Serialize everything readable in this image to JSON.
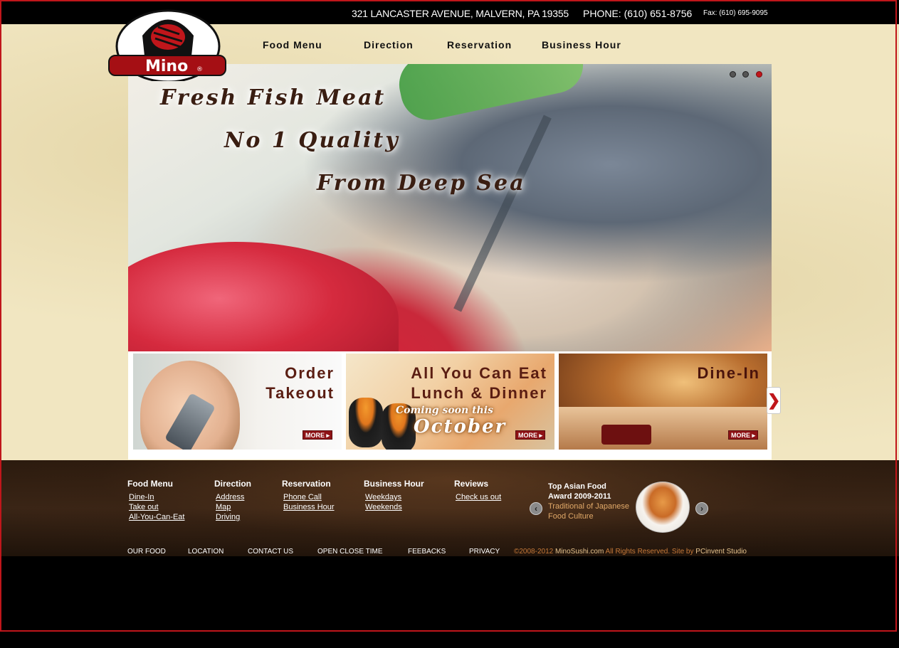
{
  "header": {
    "address": "321 LANCASTER AVENUE, MALVERN, PA 19355",
    "phone": "PHONE: (610) 651-8756",
    "fax": "Fax: (610) 695-9095"
  },
  "logo": {
    "text": "Mino",
    "mark": "®"
  },
  "nav": [
    "Food Menu",
    "Direction",
    "Reservation",
    "Business Hour"
  ],
  "hero": {
    "lines": [
      "Fresh Fish Meat",
      "No 1 Quality",
      "From Deep Sea"
    ],
    "slides": 3,
    "active_slide": 3
  },
  "promos": [
    {
      "line1": "Order",
      "line2": "Takeout",
      "more": "MORE"
    },
    {
      "line1": "All You Can Eat",
      "line2": "Lunch & Dinner",
      "sub1": "Coming soon this",
      "sub2": "October",
      "more": "MORE"
    },
    {
      "line1": "Dine-In",
      "more": "MORE"
    }
  ],
  "next_arrow": "❯",
  "footer": {
    "columns": [
      {
        "heading": "Food Menu",
        "links": [
          "Dine-In",
          "Take out",
          "All-You-Can-Eat"
        ]
      },
      {
        "heading": "Direction",
        "links": [
          "Address",
          "Map",
          "Driving"
        ]
      },
      {
        "heading": "Reservation",
        "links": [
          "Phone Call",
          "Business Hour"
        ]
      },
      {
        "heading": "Business Hour",
        "links": [
          "Weekdays",
          "Weekends"
        ]
      },
      {
        "heading": "Reviews",
        "links": [
          "Check us out"
        ]
      }
    ],
    "award": {
      "line1": "Top Asian Food",
      "line2": "Award 2009-2011",
      "line3": "Traditional of Japanese",
      "line4": "Food Culture"
    },
    "bottom_links": [
      "OUR FOOD",
      "LOCATION",
      "CONTACT US",
      "OPEN CLOSE TIME",
      "FEEBACKS",
      "PRIVACY"
    ],
    "copyright": {
      "prefix": "©2008-2012 ",
      "site": "MinoSushi.com",
      "middle": " All Rights Reserved. Site by ",
      "studio": "PCinvent Studio"
    }
  },
  "colors": {
    "brand_red": "#c0161b",
    "cream": "#f1e6c1",
    "footer_brown": "#3a2516",
    "link_orange": "#c77a3a"
  }
}
